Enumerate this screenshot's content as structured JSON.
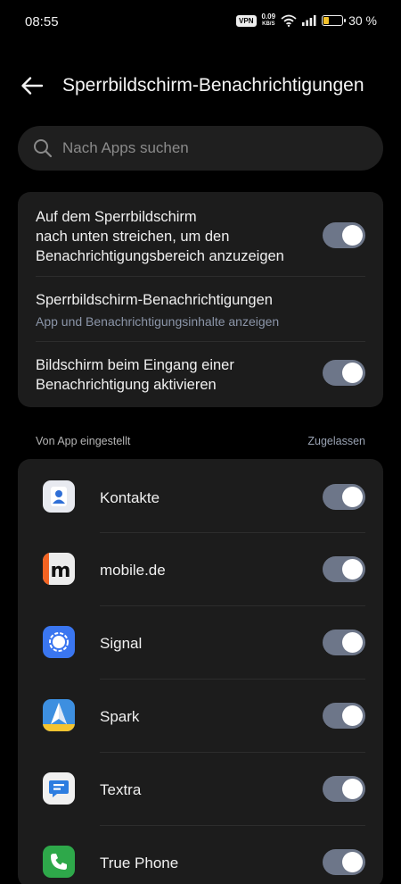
{
  "status_bar": {
    "time": "08:55",
    "vpn": "VPN",
    "net_speed": "0.09",
    "net_unit": "KB/S",
    "battery": "30 %",
    "battery_level": 0.3
  },
  "header": {
    "title": "Sperrbildschirm-Benachrichtigungen",
    "back_icon": "arrow-left-icon"
  },
  "search": {
    "placeholder": "Nach Apps suchen",
    "value": ""
  },
  "settings": [
    {
      "label": "Auf dem Sperrbildschirm nach unten streichen, um den Benachrichtigungsbereich anzuzeigen",
      "line1": "Auf dem Sperrbildschirm",
      "line2": "nach unten streichen, um den",
      "line3": "Benachrichtigungsbereich anzuzeigen",
      "enabled": true
    },
    {
      "label": "Sperrbildschirm-Benachrichtigungen",
      "sub": "App und Benachrichtigungsinhalte anzeigen"
    },
    {
      "line1": "Bildschirm beim Eingang einer",
      "line2": "Benachrichtigung aktivieren",
      "enabled": true
    }
  ],
  "section": {
    "label": "Von App eingestellt",
    "action": "Zugelassen"
  },
  "apps": [
    {
      "name": "Kontakte",
      "icon": "contacts-icon",
      "enabled": true
    },
    {
      "name": "mobile.de",
      "icon": "mobile-de-icon",
      "enabled": true
    },
    {
      "name": "Signal",
      "icon": "signal-icon",
      "enabled": true
    },
    {
      "name": "Spark",
      "icon": "spark-icon",
      "enabled": true
    },
    {
      "name": "Textra",
      "icon": "textra-icon",
      "enabled": true
    },
    {
      "name": "True Phone",
      "icon": "phone-icon",
      "enabled": true
    }
  ],
  "colors": {
    "background": "#000000",
    "card": "#1c1c1c",
    "toggle_on": "#6d7689",
    "accent_text": "#8b95a8"
  }
}
